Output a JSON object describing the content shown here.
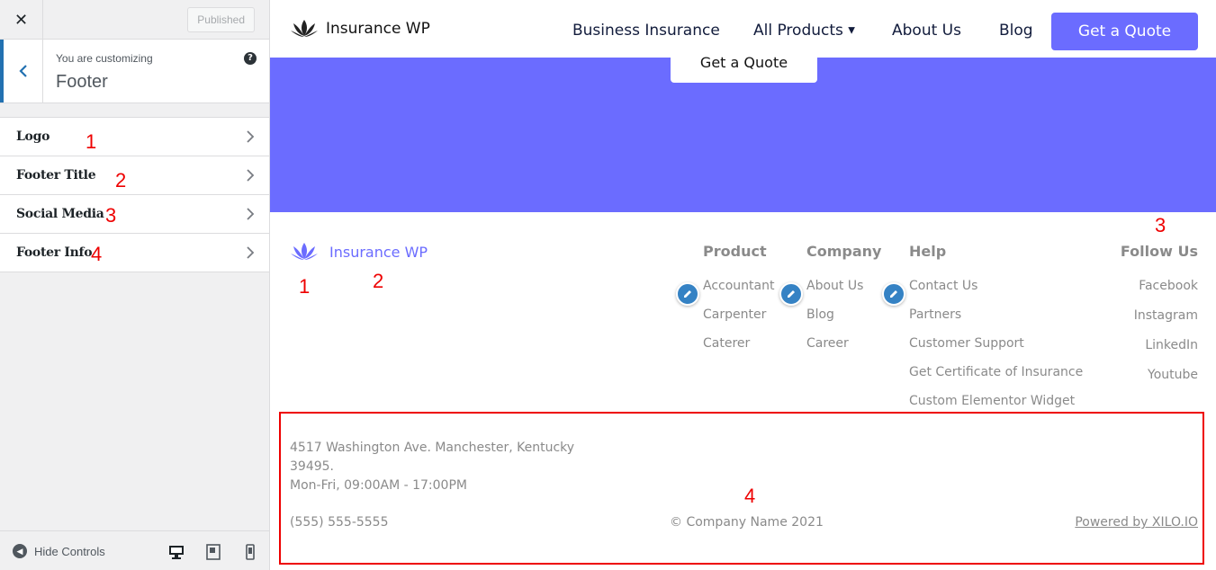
{
  "customizer": {
    "close_label": "✕",
    "publish_label": "Published",
    "customizing_label": "You are customizing",
    "panel_title": "Footer",
    "help_label": "?",
    "sections": [
      {
        "label": "Logo",
        "marker": "1"
      },
      {
        "label": "Footer Title",
        "marker": "2"
      },
      {
        "label": "Social Media",
        "marker": "3"
      },
      {
        "label": "Footer Info",
        "marker": "4"
      }
    ],
    "hide_controls_label": "Hide Controls"
  },
  "site": {
    "brand_name": "Insurance WP",
    "nav": [
      {
        "label": "Business Insurance"
      },
      {
        "label": "All Products"
      },
      {
        "label": "About Us"
      },
      {
        "label": "Blog"
      }
    ],
    "nav_cta": "Get a Quote",
    "hero_cta": "Get a Quote",
    "accent_color": "#6b6cff"
  },
  "footer": {
    "brand_name": "Insurance WP",
    "columns": [
      {
        "title": "Product",
        "links": [
          "Accountant",
          "Carpenter",
          "Caterer"
        ]
      },
      {
        "title": "Company",
        "links": [
          "About Us",
          "Blog",
          "Career"
        ]
      },
      {
        "title": "Help",
        "links": [
          "Contact Us",
          "Partners",
          "Customer Support",
          "Get Certificate of Insurance",
          "Custom Elementor Widget"
        ]
      }
    ],
    "follow": {
      "title": "Follow Us",
      "links": [
        "Facebook",
        "Instagram",
        "LinkedIn",
        "Youtube"
      ]
    },
    "address_line1": "4517 Washington Ave. Manchester, Kentucky",
    "address_line2": "39495.",
    "hours": "Mon-Fri, 09:00AM - 17:00PM",
    "phone": "(555) 555-5555",
    "copyright": "© Company Name 2021",
    "powered": "Powered by XILO.IO"
  },
  "annotations": {
    "logo_marker": "1",
    "title_marker": "2",
    "social_marker": "3",
    "info_marker": "4"
  }
}
